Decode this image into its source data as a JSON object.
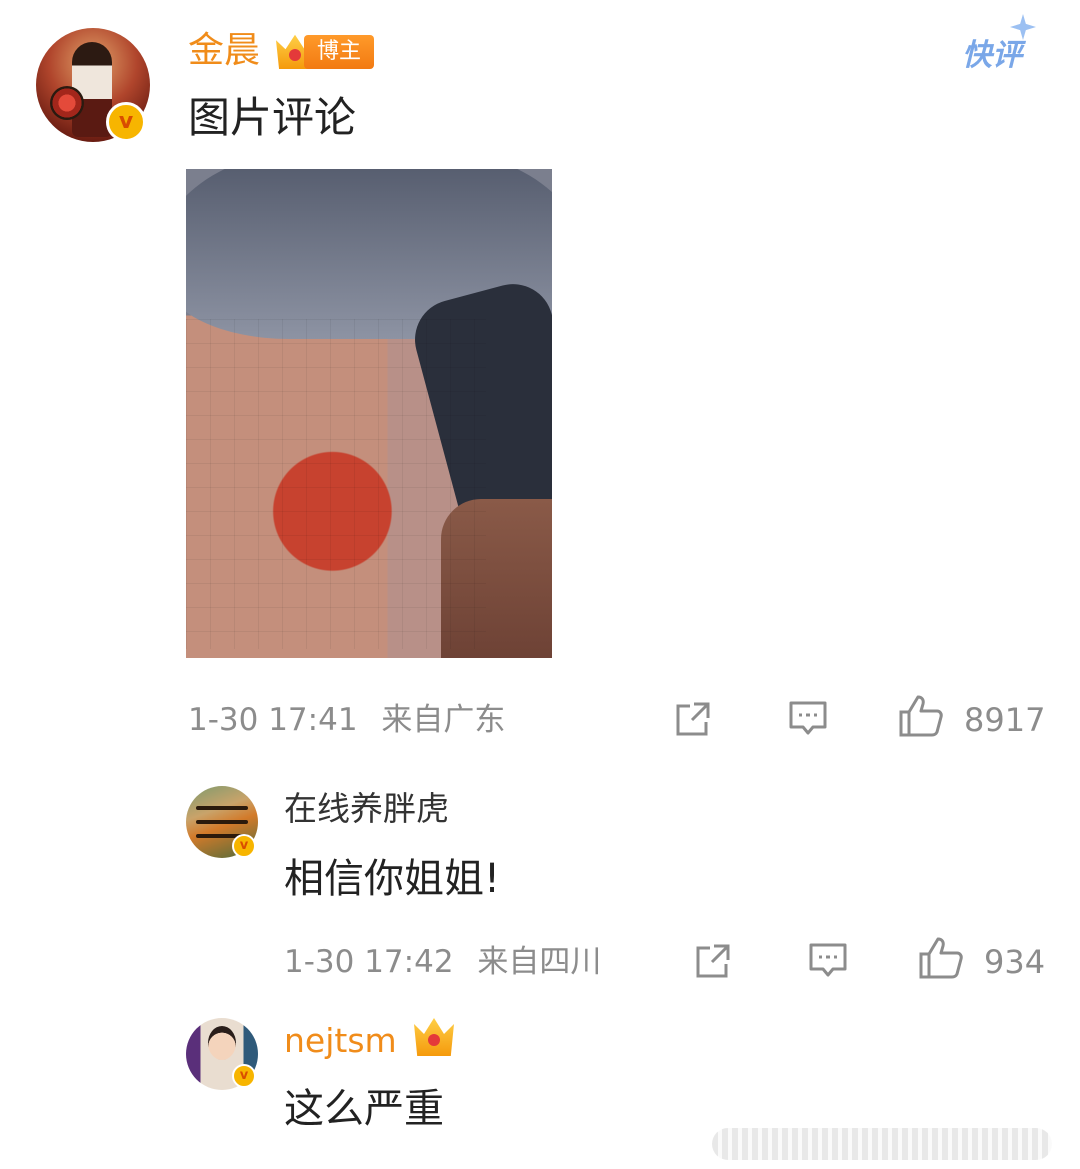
{
  "main_comment": {
    "username": "金晨",
    "badge": "博主",
    "app_label": "快评",
    "text": "图片评论",
    "time": "1-30 17:41",
    "location": "来自广东",
    "likes": "8917",
    "verified_icon": "v-verified-icon",
    "crown_level_icon": "crown-icon"
  },
  "replies": [
    {
      "username": "在线养胖虎",
      "text": "相信你姐姐!",
      "time": "1-30 17:42",
      "location": "来自四川",
      "likes": "934"
    },
    {
      "username": "nejtsm",
      "text": "这么严重"
    }
  ],
  "colors": {
    "username_orange": "#f08c1a",
    "meta_gray": "#8c8c8c",
    "verify_gold": "#f7b500",
    "kuaiping_blue": "#7aa7e8"
  }
}
